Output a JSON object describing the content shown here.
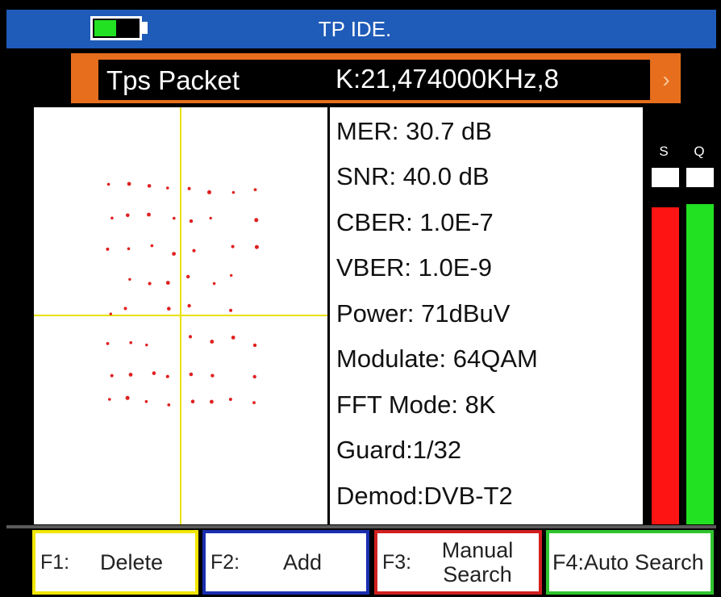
{
  "title": "TP IDE.",
  "battery": {
    "level": 0.5,
    "fill_color": "#22e022"
  },
  "selector": {
    "label": "Tps Packet",
    "value": "K:21,474000KHz,8",
    "arrow": "›"
  },
  "params": [
    "MER: 30.7 dB",
    "SNR: 40.0 dB",
    "CBER: 1.0E-7",
    "VBER: 1.0E-9",
    "Power: 71dBuV",
    "Modulate: 64QAM",
    "FFT Mode: 8K",
    "Guard:1/32",
    "Demod:DVB-T2"
  ],
  "meters": {
    "s": {
      "label": "S",
      "level": 0.94,
      "color": "#ff1414"
    },
    "q": {
      "label": "Q",
      "level": 0.95,
      "color": "#22e022"
    }
  },
  "function_keys": {
    "f1": {
      "key": "F1:",
      "label": "Delete",
      "color": "#f2e600"
    },
    "f2": {
      "key": "F2:",
      "label": "Add",
      "color": "#1a2fb0"
    },
    "f3": {
      "key": "F3:",
      "label": "Manual Search",
      "color": "#d11f1f"
    },
    "f4": {
      "key": "",
      "label": "F4:Auto Search",
      "color": "#2fc52f"
    }
  },
  "colors": {
    "title_bar": "#1f5bb8",
    "selector_bar": "#e66e1c",
    "axis": "#e8e000",
    "constellation_point": "#e02020"
  },
  "constellation": {
    "grid": "8x8 (64QAM)"
  }
}
